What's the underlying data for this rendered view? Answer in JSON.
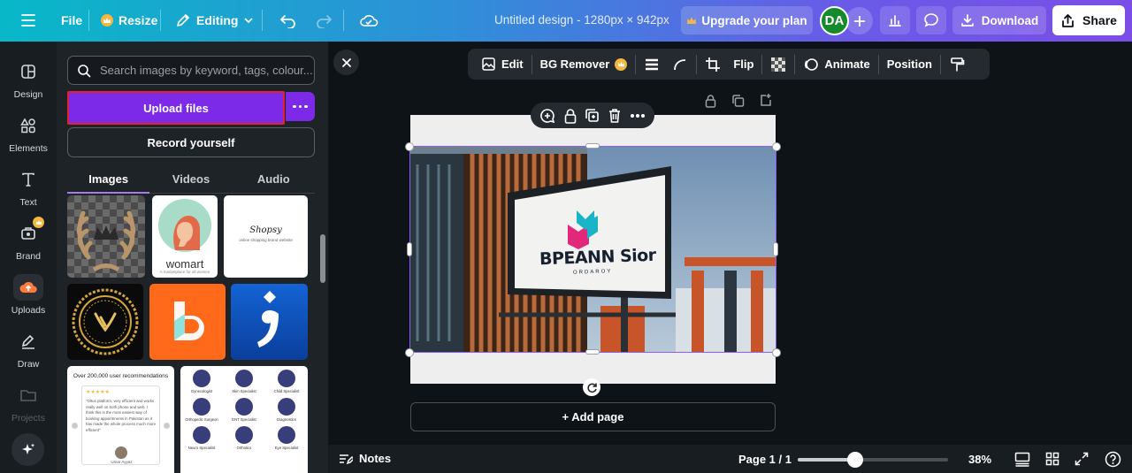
{
  "topbar": {
    "file_label": "File",
    "resize_label": "Resize",
    "editing_label": "Editing",
    "title": "Untitled design - 1280px × 942px",
    "upgrade_label": "Upgrade your plan",
    "avatar_initials": "DA",
    "download_label": "Download",
    "share_label": "Share"
  },
  "rail": {
    "items": [
      {
        "label": "Design",
        "icon": "design-icon"
      },
      {
        "label": "Elements",
        "icon": "elements-icon"
      },
      {
        "label": "Text",
        "icon": "text-icon"
      },
      {
        "label": "Brand",
        "icon": "brand-icon"
      },
      {
        "label": "Uploads",
        "icon": "uploads-icon"
      },
      {
        "label": "Draw",
        "icon": "draw-icon"
      },
      {
        "label": "Projects",
        "icon": "projects-icon"
      }
    ]
  },
  "panel": {
    "search_placeholder": "Search images by keyword, tags, colour...",
    "upload_label": "Upload files",
    "record_label": "Record yourself",
    "tabs": [
      {
        "label": "Images",
        "active": true
      },
      {
        "label": "Videos",
        "active": false
      },
      {
        "label": "Audio",
        "active": false
      }
    ],
    "thumbs": {
      "womart_text": "womart",
      "womart_sub": "A marketplace for all women",
      "shopsy_text": "Shopsy",
      "shopsy_sub": "online shopping brand website",
      "testimonial_heading": "Over 200,000 user recommendations",
      "testimonial_stars": "★★★★★",
      "testimonial_body": "\"Oltus platform, very efficient and works really well on both phone and web. I think this is the most easiest way of booking appointments in Pakistan as it has made the whole process much more efficient\"",
      "testimonial_name": "Umar Ayyaz",
      "specialists": [
        "Gynecologist",
        "Skin Specialist",
        "Child Specialist",
        "Orthopedic Surgeon",
        "ENT Specialist",
        "Diagnostics",
        "Neuro Specialist",
        "Orthotics",
        "Eye Specialist"
      ]
    }
  },
  "context_toolbar": {
    "edit_label": "Edit",
    "bg_remover_label": "BG Remover",
    "flip_label": "Flip",
    "animate_label": "Animate",
    "position_label": "Position"
  },
  "canvas": {
    "billboard_brand": "BPEANN Sior",
    "billboard_tagline": "ORDAROY",
    "add_page_label": "+ Add page"
  },
  "bottom": {
    "notes_label": "Notes",
    "page_indicator": "Page 1 / 1",
    "zoom_value": 0.38,
    "zoom_label": "38%"
  },
  "colors": {
    "accent_purple": "#7d2ae8",
    "selection": "#8b5cf6",
    "highlight_red": "#e0242f",
    "crown_gold": "#f4b740"
  }
}
